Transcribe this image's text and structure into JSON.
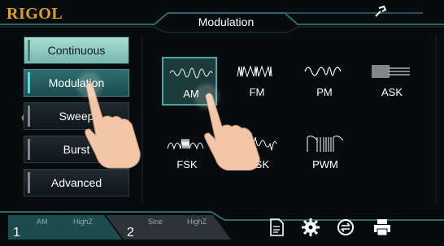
{
  "header": {
    "brand": "RIGOL",
    "title": "Modulation",
    "status_icon": "wrench-plug-icon"
  },
  "menu": {
    "items": [
      {
        "label": "Continuous",
        "state": "pale"
      },
      {
        "label": "Modulation",
        "state": "active"
      },
      {
        "label": "Sweep",
        "state": "normal"
      },
      {
        "label": "Burst",
        "state": "normal"
      },
      {
        "label": "Advanced",
        "state": "normal"
      }
    ],
    "left_arrow": "〈"
  },
  "modulation_types": [
    {
      "label": "AM",
      "selected": true
    },
    {
      "label": "FM"
    },
    {
      "label": "PM"
    },
    {
      "label": "ASK"
    },
    {
      "label": "FSK"
    },
    {
      "label": "PSK"
    },
    {
      "label": "PWM"
    }
  ],
  "bottom_bar": {
    "ch1": {
      "number": "1",
      "wave": "AM",
      "load": "HighZ"
    },
    "ch2": {
      "number": "2",
      "wave": "Sine",
      "load": "HighZ"
    },
    "icons": [
      "document-icon",
      "gear-icon",
      "sync-icon",
      "printer-icon"
    ]
  },
  "colors": {
    "accent": "#4aa6a0",
    "brand": "#e0a21a",
    "pale_button": "#a8ded6"
  }
}
